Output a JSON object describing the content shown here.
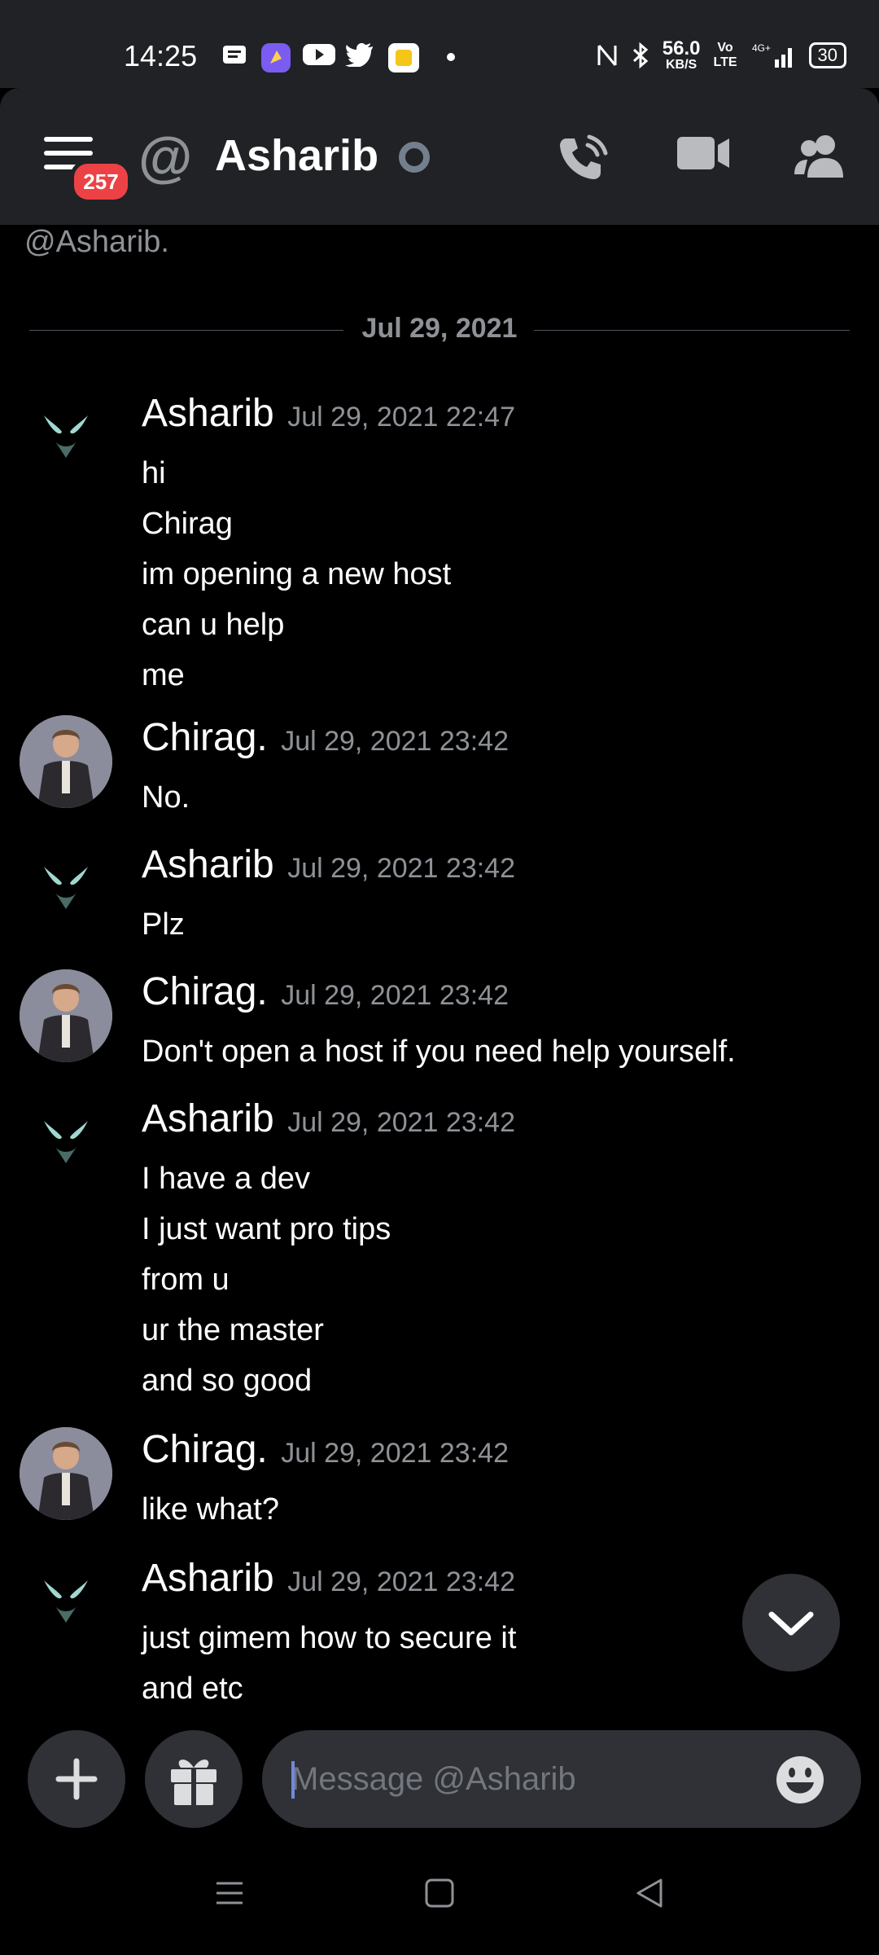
{
  "status_bar": {
    "time": "14:25",
    "net_speed_value": "56.0",
    "net_speed_unit": "KB/S",
    "volte": "Vo\nLTE",
    "signal": "4G+",
    "battery": "30"
  },
  "header": {
    "title": "Asharib",
    "badge_count": "257",
    "at_symbol": "@"
  },
  "chat": {
    "partial_mention": "@Asharib.",
    "date_divider": "Jul 29, 2021",
    "groups": [
      {
        "author": "Asharib",
        "timestamp": "Jul 29, 2021 22:47",
        "lines": [
          "hi",
          "Chirag",
          "im opening a new host",
          "can u help",
          "me"
        ]
      },
      {
        "author": "Chirag.",
        "timestamp": "Jul 29, 2021 23:42",
        "lines": [
          "No."
        ]
      },
      {
        "author": "Asharib",
        "timestamp": "Jul 29, 2021 23:42",
        "lines": [
          "Plz"
        ]
      },
      {
        "author": "Chirag.",
        "timestamp": "Jul 29, 2021 23:42",
        "lines": [
          "Don't open a host if you need help yourself."
        ]
      },
      {
        "author": "Asharib",
        "timestamp": "Jul 29, 2021 23:42",
        "lines": [
          "I have a dev",
          "I just want pro tips",
          "from u",
          "ur the master",
          "and so good"
        ]
      },
      {
        "author": "Chirag.",
        "timestamp": "Jul 29, 2021 23:42",
        "lines": [
          "like what?"
        ]
      },
      {
        "author": "Asharib",
        "timestamp": "Jul 29, 2021 23:42",
        "lines": [
          "just gimem how to secure it",
          "and etc"
        ]
      }
    ]
  },
  "input": {
    "placeholder": "Message @Asharib"
  },
  "colors": {
    "background": "#000000",
    "header": "#202225",
    "input": "#2f3136",
    "badge": "#ed4245",
    "muted": "#8e9297"
  },
  "icons": [
    "menu-icon",
    "at-icon",
    "call-icon",
    "video-icon",
    "members-icon",
    "plus-icon",
    "gift-icon",
    "emoji-icon",
    "chevron-down-icon"
  ]
}
